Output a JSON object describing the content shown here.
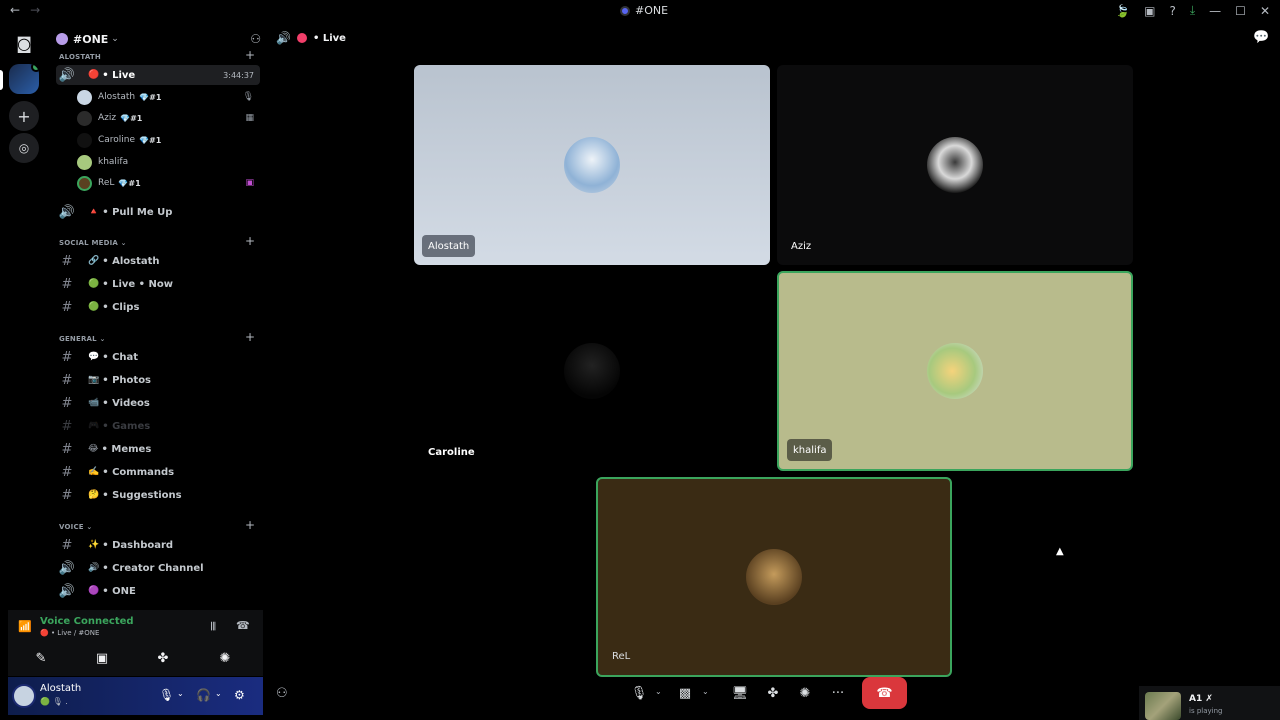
{
  "window": {
    "title": "#ONE",
    "nav_back": "←",
    "nav_forward": "→",
    "icons": {
      "leaf": "🍃",
      "inbox": "▣",
      "help": "?",
      "download": "⤓",
      "minimize": "—",
      "maximize": "☐",
      "close": "✕"
    }
  },
  "rail": {
    "home_icon": "◙",
    "add_icon": "+",
    "explore_icon": "◎"
  },
  "server": {
    "name": "#ONE",
    "chevron": "⌄",
    "invite_icon": "⚇"
  },
  "categories": {
    "alostath": "ALOSTATH",
    "social": "SOCIAL MEDIA ⌄",
    "general": "GENERAL ⌄",
    "voice": "VOICE ⌄",
    "plus": "+"
  },
  "live_channel": {
    "icon": "🔊",
    "dot": "🔴",
    "label": "• Live",
    "timer": "3:44:37"
  },
  "voice_users": [
    {
      "name": "Alostath",
      "gem": "💎",
      "rank": "#1",
      "status": "🎙",
      "avatar_color": "#c9d6e4"
    },
    {
      "name": "Aziz",
      "gem": "💎",
      "rank": "#1",
      "status": "▦",
      "avatar_color": "#2b2b2b"
    },
    {
      "name": "Caroline",
      "gem": "💎",
      "rank": "#1",
      "status": "",
      "avatar_color": "#111111"
    },
    {
      "name": "khalifa",
      "gem": "",
      "rank": "",
      "status": "",
      "avatar_color": "#a7c97e"
    },
    {
      "name": "ReL",
      "gem": "💎",
      "rank": "#1",
      "status": "▣",
      "avatar_color": "#5a4020"
    }
  ],
  "channels": {
    "pull_me_up": {
      "icon": "🔊",
      "emoji": "🔺",
      "label": "• Pull Me Up"
    },
    "social": [
      {
        "emoji": "🔗",
        "label": "• Alostath"
      },
      {
        "emoji": "🟢",
        "label": "• Live • Now"
      },
      {
        "emoji": "🟢",
        "label": "• Clips"
      }
    ],
    "general": [
      {
        "emoji": "💬",
        "label": "• Chat"
      },
      {
        "emoji": "📷",
        "label": "• Photos"
      },
      {
        "emoji": "📹",
        "label": "• Videos"
      },
      {
        "emoji": "🎮",
        "label": "• Games"
      },
      {
        "emoji": "😂",
        "label": "• Memes"
      },
      {
        "emoji": "✍️",
        "label": "• Commands"
      },
      {
        "emoji": "🤔",
        "label": "• Suggestions"
      }
    ],
    "voice": [
      {
        "type": "text",
        "emoji": "✨",
        "label": "• Dashboard"
      },
      {
        "type": "voice",
        "emoji": "🔊",
        "label": "• Creator Channel"
      },
      {
        "type": "voice",
        "emoji": "🟣",
        "label": "• ONE"
      }
    ],
    "hash": "#",
    "speaker": "🔊"
  },
  "voice_panel": {
    "title": "Voice Connected",
    "subtitle": "🔴 • Live / #ONE",
    "signal_icon": "📶",
    "wave_icon": "𝄃𝄃",
    "disconnect_icon": "☎",
    "buttons": [
      "✎",
      "▣",
      "✤",
      "✺"
    ]
  },
  "user_panel": {
    "name": "Alostath",
    "sub": "🟢 🎙 .",
    "mic": "🎙",
    "headset": "🎧",
    "settings": "⚙",
    "chevron": "⌄"
  },
  "stage": {
    "speaker_icon": "🔊",
    "label": "• Live",
    "chat_icon": "💬"
  },
  "tiles": [
    {
      "name": "Alostath"
    },
    {
      "name": "Aziz"
    },
    {
      "name": "Caroline"
    },
    {
      "name": "khalifa"
    },
    {
      "name": "ReL"
    }
  ],
  "call_controls": {
    "mic": "🎙",
    "camera": "▩",
    "screen": "🖥",
    "activities": "✤",
    "soundboard": "✺",
    "more": "···",
    "end": "☎",
    "chevron": "⌄"
  },
  "add_friend_icon": "⚇",
  "activity": {
    "name": "A1 ✗",
    "sub": "is playing"
  },
  "colors": {
    "accent_green": "#3ba55d",
    "live_red": "#f23f6a",
    "end_call_red": "#da373c",
    "blurple": "#5865f2"
  }
}
